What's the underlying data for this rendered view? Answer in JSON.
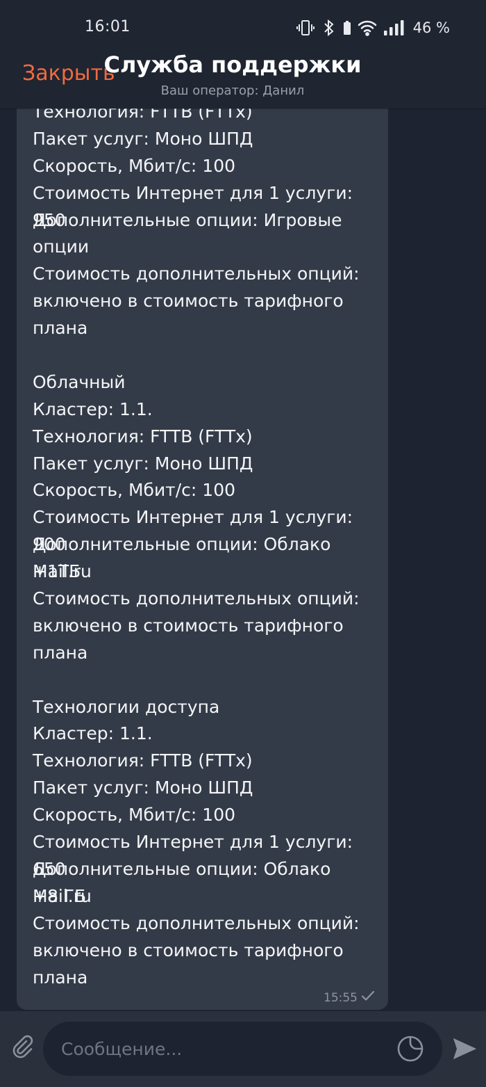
{
  "status_bar": {
    "time": "16:01",
    "battery": "46 %",
    "icons": [
      "vibrate-icon",
      "bluetooth-icon",
      "wifi-icon",
      "signal-icon"
    ]
  },
  "header": {
    "close_label": "Закрыть",
    "title": "Служба поддержки",
    "subtitle": "Ваш оператор: Данил"
  },
  "message": {
    "lines": [
      "Технология: FTTB (FTTx)",
      "Пакет услуг: Моно ШПД",
      "Скорость, Мбит/с: 100",
      "Стоимость Интернет для 1 услуги: 950",
      "Дополнительные опции: Игровые",
      "опции",
      "Стоимость дополнительных опций:",
      "включено в стоимость тарифного",
      "плана",
      "",
      "Облачный",
      "Кластер: 1.1.",
      "Технология: FTTB (FTTx)",
      "Пакет услуг: Моно ШПД",
      "Скорость, Мбит/с: 100",
      "Стоимость Интернет для 1 услуги: 900",
      "Дополнительные опции: Облако Mail.ru",
      "+1ТБ",
      "Стоимость дополнительных опций:",
      "включено в стоимость тарифного",
      "плана",
      "",
      "Технологии доступа",
      "Кластер: 1.1.",
      "Технология: FTTB (FTTx)",
      "Пакет услуг: Моно ШПД",
      "Скорость, Мбит/с: 100",
      "Стоимость Интернет для 1 услуги: 650",
      "Дополнительные опции: Облако Mail.ru",
      "+8 ГБ",
      "Стоимость дополнительных опций:",
      "включено в стоимость тарифного",
      "плана"
    ],
    "time": "15:55",
    "status_icon": "checkmark-icon"
  },
  "composer": {
    "placeholder": "Сообщение...",
    "attach_icon": "paperclip-icon",
    "sticker_icon": "sticker-icon",
    "send_icon": "send-icon"
  },
  "colors": {
    "accent": "#f26a3f",
    "background": "#1d2330",
    "bubble": "#343b48",
    "header": "#1f2531",
    "composer": "#2b313c"
  }
}
